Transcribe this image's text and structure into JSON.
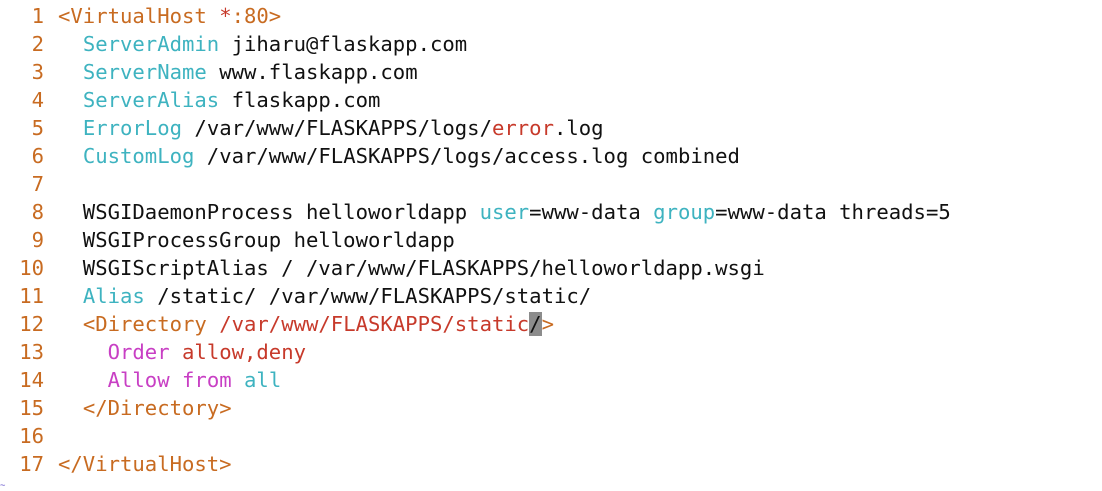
{
  "editor": {
    "lines": [
      {
        "n": "1",
        "segs": [
          {
            "t": "<VirtualHost ",
            "c": "c-tag"
          },
          {
            "t": "*",
            "c": "c-err"
          },
          {
            "t": ":80>",
            "c": "c-tag"
          }
        ]
      },
      {
        "n": "2",
        "segs": [
          {
            "t": "  ",
            "c": "c-plain"
          },
          {
            "t": "ServerAdmin",
            "c": "c-dir"
          },
          {
            "t": " jiharu@flaskapp.com",
            "c": "c-plain"
          }
        ]
      },
      {
        "n": "3",
        "segs": [
          {
            "t": "  ",
            "c": "c-plain"
          },
          {
            "t": "ServerName",
            "c": "c-dir"
          },
          {
            "t": " www.flaskapp.com",
            "c": "c-plain"
          }
        ]
      },
      {
        "n": "4",
        "segs": [
          {
            "t": "  ",
            "c": "c-plain"
          },
          {
            "t": "ServerAlias",
            "c": "c-dir"
          },
          {
            "t": " flaskapp.com",
            "c": "c-plain"
          }
        ]
      },
      {
        "n": "5",
        "segs": [
          {
            "t": "  ",
            "c": "c-plain"
          },
          {
            "t": "ErrorLog",
            "c": "c-dir"
          },
          {
            "t": " /var/www/FLASKAPPS/logs/",
            "c": "c-plain"
          },
          {
            "t": "error",
            "c": "c-err"
          },
          {
            "t": ".log",
            "c": "c-plain"
          }
        ]
      },
      {
        "n": "6",
        "segs": [
          {
            "t": "  ",
            "c": "c-plain"
          },
          {
            "t": "CustomLog",
            "c": "c-dir"
          },
          {
            "t": " /var/www/FLASKAPPS/logs/access.log combined",
            "c": "c-plain"
          }
        ]
      },
      {
        "n": "7",
        "segs": []
      },
      {
        "n": "8",
        "segs": [
          {
            "t": "  WSGIDaemonProcess helloworldapp ",
            "c": "c-plain"
          },
          {
            "t": "user",
            "c": "c-dir"
          },
          {
            "t": "=www-data ",
            "c": "c-plain"
          },
          {
            "t": "group",
            "c": "c-dir"
          },
          {
            "t": "=www-data threads=5",
            "c": "c-plain"
          }
        ]
      },
      {
        "n": "9",
        "segs": [
          {
            "t": "  WSGIProcessGroup helloworldapp",
            "c": "c-plain"
          }
        ]
      },
      {
        "n": "10",
        "segs": [
          {
            "t": "  WSGIScriptAlias / /var/www/FLASKAPPS/helloworldapp.wsgi",
            "c": "c-plain"
          }
        ]
      },
      {
        "n": "11",
        "segs": [
          {
            "t": "  ",
            "c": "c-plain"
          },
          {
            "t": "Alias",
            "c": "c-dir"
          },
          {
            "t": " /static/ /var/www/FLASKAPPS/static/",
            "c": "c-plain"
          }
        ]
      },
      {
        "n": "12",
        "segs": [
          {
            "t": "  ",
            "c": "c-plain"
          },
          {
            "t": "<Directory ",
            "c": "c-tag"
          },
          {
            "t": "/var/www/FLASKAPPS/static",
            "c": "c-path"
          },
          {
            "t": "/",
            "c": "cursor"
          },
          {
            "t": ">",
            "c": "c-tag"
          }
        ]
      },
      {
        "n": "13",
        "segs": [
          {
            "t": "    ",
            "c": "c-plain"
          },
          {
            "t": "Order",
            "c": "c-mag"
          },
          {
            "t": " ",
            "c": "c-plain"
          },
          {
            "t": "allow,deny",
            "c": "c-err"
          }
        ]
      },
      {
        "n": "14",
        "segs": [
          {
            "t": "    ",
            "c": "c-plain"
          },
          {
            "t": "Allow",
            "c": "c-mag"
          },
          {
            "t": " ",
            "c": "c-plain"
          },
          {
            "t": "from",
            "c": "c-mag"
          },
          {
            "t": " ",
            "c": "c-plain"
          },
          {
            "t": "all",
            "c": "c-dir"
          }
        ]
      },
      {
        "n": "15",
        "segs": [
          {
            "t": "  ",
            "c": "c-plain"
          },
          {
            "t": "</Directory>",
            "c": "c-tag"
          }
        ]
      },
      {
        "n": "16",
        "segs": []
      },
      {
        "n": "17",
        "segs": [
          {
            "t": "</VirtualHost>",
            "c": "c-tag"
          }
        ]
      }
    ],
    "status_mark": "~"
  },
  "colors": {
    "line_number": "#c86b21",
    "tag": "#c86b21",
    "directive": "#3eb3c0",
    "error_value": "#c73a2b",
    "keyword": "#c83fc4",
    "text": "#111111",
    "cursor": "#8c8c8c",
    "background": "#ffffff"
  }
}
